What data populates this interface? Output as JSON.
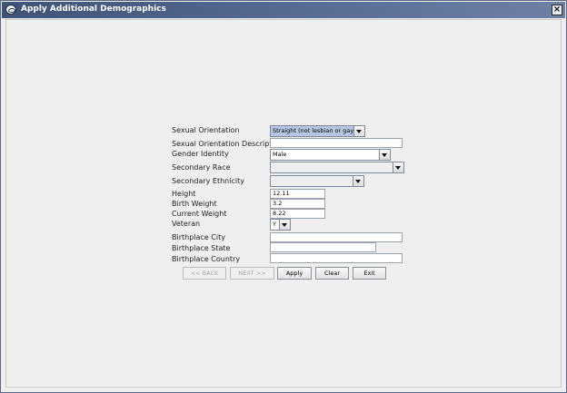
{
  "window": {
    "title": "Apply Additional Demographics",
    "close_glyph": "×"
  },
  "labels": {
    "sexual_orientation": "Sexual Orientation",
    "sexual_orientation_description": "Sexual Orientation Description",
    "gender_identity": "Gender Identity",
    "secondary_race": "Secondary Race",
    "secondary_ethnicity": "Secondary Ethnicity",
    "height": "Height",
    "birth_weight": "Birth Weight",
    "current_weight": "Current Weight",
    "veteran": "Veteran",
    "birthplace_city": "Birthplace City",
    "birthplace_state": "Birthplace State",
    "birthplace_country": "Birthplace Country"
  },
  "values": {
    "sexual_orientation": "Straight (not lesbian or gay)",
    "sexual_orientation_description": "",
    "gender_identity": "Male",
    "secondary_race": "",
    "secondary_ethnicity": "",
    "height": "12.11",
    "birth_weight": "3.2",
    "current_weight": "8.22",
    "veteran": "Y",
    "birthplace_city": "",
    "birthplace_state": "",
    "birthplace_country": ""
  },
  "buttons": {
    "back": "<< BACK",
    "next": "NEXT >>",
    "apply": "Apply",
    "clear": "Clear",
    "exit": "Exit"
  },
  "colors": {
    "titlebar": "#3f5378",
    "selected_combo": "#b5c7e3",
    "panel": "#efefef"
  },
  "icons": {
    "window": "app-globe-icon",
    "dropdown": "dropdown-arrow-icon",
    "close": "close-icon"
  }
}
